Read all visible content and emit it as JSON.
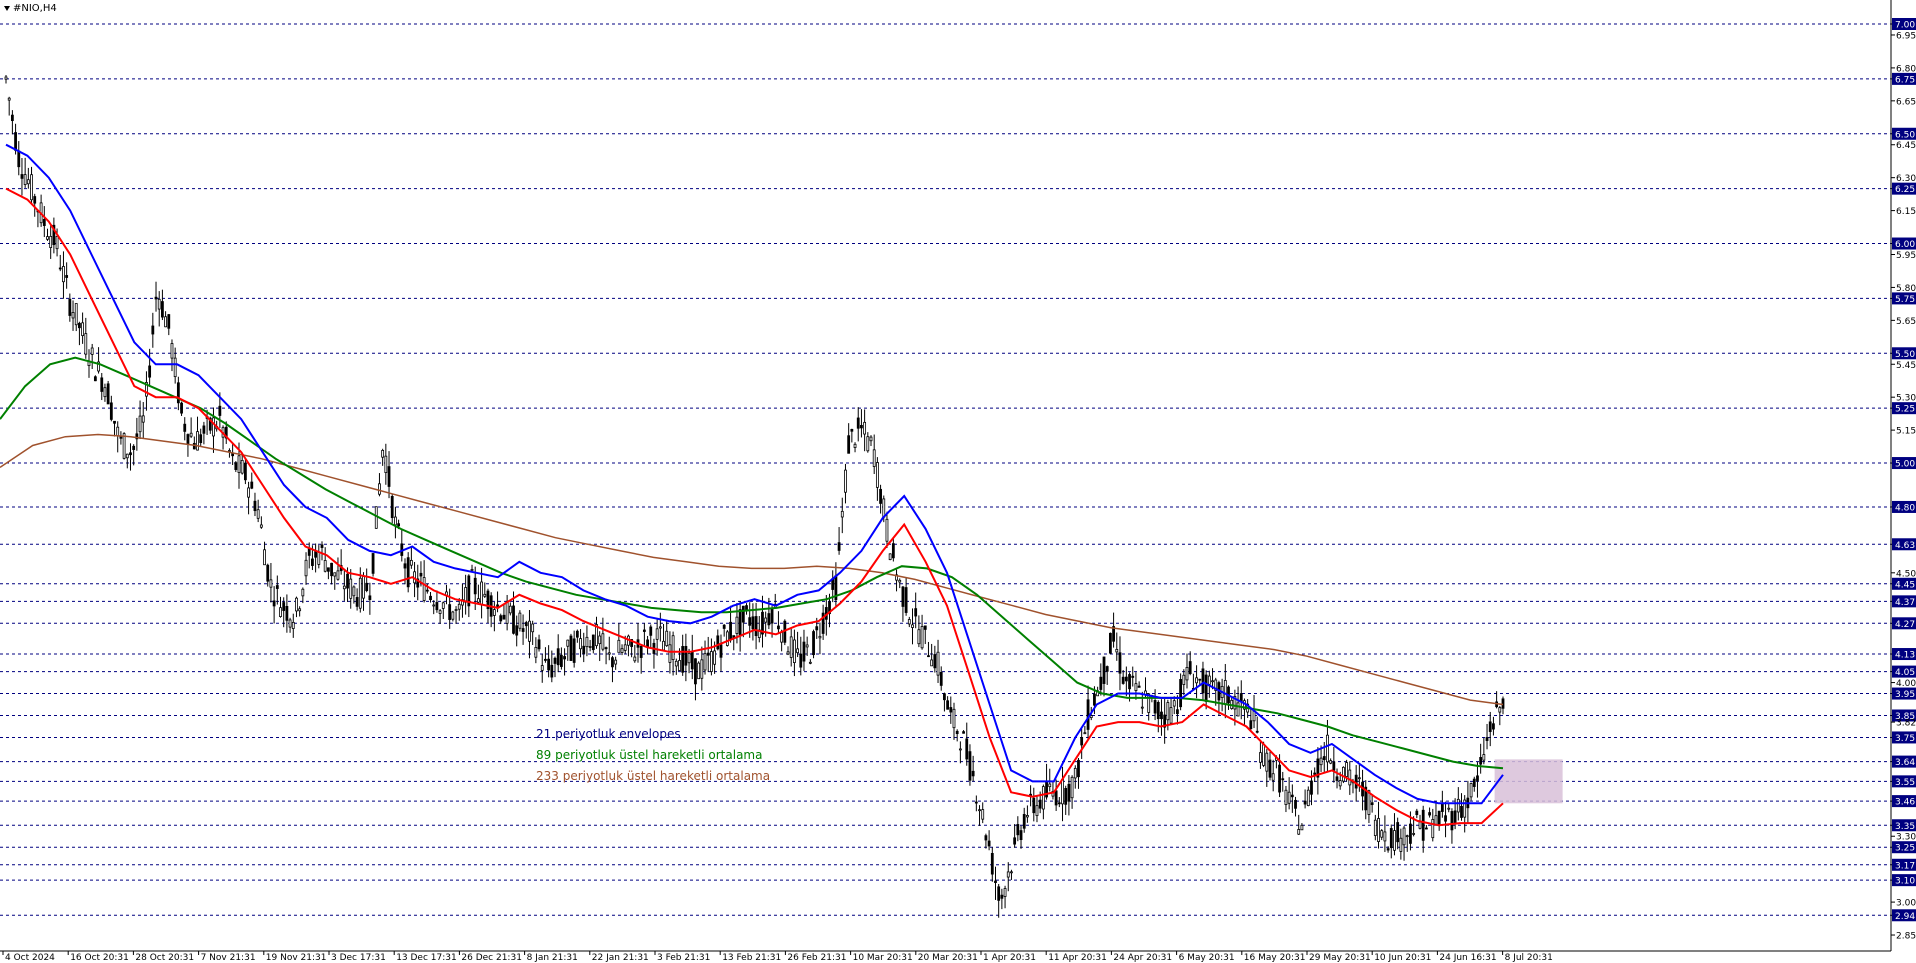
{
  "title": "#NIO,H4",
  "colors": {
    "envelope_upper": "#0000ff",
    "envelope_lower": "#ff0000",
    "ema89": "#008000",
    "ema233": "#a0522d",
    "highlight_zone": "#d8bfd8",
    "grid": "#000080",
    "candle": "#000000"
  },
  "legend": [
    {
      "label": "21 periyotluk envelopes",
      "color": "#000080"
    },
    {
      "label": "89 periyotluk üstel hareketli ortalama",
      "color": "#008000"
    },
    {
      "label": "233 periyotluk üstel hareketli ortalama",
      "color": "#a0522d"
    }
  ],
  "chart_data": {
    "type": "line",
    "price_range": [
      2.8,
      7.0
    ],
    "grid": "dashed horizontal at key levels",
    "y_ticks": [
      "7.00",
      "6.95",
      "6.80",
      "6.75",
      "6.65",
      "6.50",
      "6.45",
      "6.30",
      "6.25",
      "6.15",
      "6.00",
      "5.95",
      "5.80",
      "5.75",
      "5.65",
      "5.50",
      "5.45",
      "5.30",
      "5.25",
      "5.15",
      "5.00",
      "4.80",
      "4.63",
      "4.50",
      "4.45",
      "4.37",
      "4.27",
      "4.13",
      "4.05",
      "4.00",
      "3.95",
      "3.85",
      "3.82",
      "3.75",
      "3.64",
      "3.55",
      "3.46",
      "3.35",
      "3.30",
      "3.25",
      "3.17",
      "3.10",
      "3.00",
      "2.94",
      "2.85"
    ],
    "highlighted_levels": [
      "7.00",
      "6.75",
      "6.50",
      "6.25",
      "6.00",
      "5.75",
      "5.50",
      "5.25",
      "5.00",
      "4.80",
      "4.63",
      "4.45",
      "4.37",
      "4.27",
      "4.13",
      "4.05",
      "3.95",
      "3.85",
      "3.75",
      "3.64",
      "3.55",
      "3.46",
      "3.35",
      "3.25",
      "3.17",
      "3.10",
      "2.94"
    ],
    "x_ticks": [
      "4 Oct 2024",
      "16 Oct 20:31",
      "28 Oct 20:31",
      "7 Nov 21:31",
      "19 Nov 21:31",
      "3 Dec 17:31",
      "13 Dec 17:31",
      "26 Dec 21:31",
      "8 Jan 21:31",
      "22 Jan 21:31",
      "3 Feb 21:31",
      "13 Feb 21:31",
      "26 Feb 21:31",
      "10 Mar 20:31",
      "20 Mar 20:31",
      "1 Apr 20:31",
      "11 Apr 20:31",
      "24 Apr 20:31",
      "6 May 20:31",
      "16 May 20:31",
      "29 May 20:31",
      "10 Jun 20:31",
      "24 Jun 16:31",
      "8 Jul 20:31"
    ],
    "price_path": [
      6.75,
      6.4,
      6.25,
      6.1,
      6.0,
      5.75,
      5.6,
      5.45,
      5.35,
      5.1,
      5.05,
      5.2,
      5.8,
      5.6,
      5.2,
      5.1,
      5.15,
      5.2,
      5.0,
      4.95,
      4.8,
      4.45,
      4.35,
      4.3,
      4.55,
      4.6,
      4.5,
      4.45,
      4.4,
      4.45,
      5.1,
      4.7,
      4.5,
      4.45,
      4.4,
      4.35,
      4.3,
      4.45,
      4.4,
      4.35,
      4.3,
      4.25,
      4.2,
      4.05,
      4.1,
      4.15,
      4.2,
      4.2,
      4.1,
      4.15,
      4.15,
      4.2,
      4.2,
      4.15,
      4.1,
      4.05,
      4.1,
      4.2,
      4.25,
      4.3,
      4.25,
      4.35,
      4.2,
      4.1,
      4.15,
      4.3,
      4.45,
      5.1,
      5.15,
      5.05,
      4.7,
      4.45,
      4.3,
      4.2,
      4.1,
      3.85,
      3.75,
      3.55,
      3.3,
      3.0,
      3.2,
      3.4,
      3.45,
      3.5,
      3.5,
      3.55,
      3.85,
      4.0,
      4.2,
      4.0,
      3.95,
      3.9,
      3.85,
      3.9,
      4.05,
      4.0,
      3.95,
      3.95,
      3.9,
      3.85,
      3.65,
      3.6,
      3.45,
      3.35,
      3.6,
      3.7,
      3.6,
      3.55,
      3.5,
      3.35,
      3.3,
      3.3,
      3.35,
      3.35,
      3.38,
      3.4,
      3.45,
      3.55,
      3.8,
      3.9
    ],
    "series": [
      {
        "name": "21 periyotluk envelopes",
        "key": "env_upper",
        "values": [
          6.45,
          6.4,
          6.3,
          6.15,
          5.95,
          5.75,
          5.55,
          5.45,
          5.45,
          5.4,
          5.3,
          5.2,
          5.05,
          4.9,
          4.8,
          4.75,
          4.65,
          4.6,
          4.58,
          4.62,
          4.55,
          4.52,
          4.5,
          4.48,
          4.55,
          4.5,
          4.48,
          4.42,
          4.38,
          4.35,
          4.3,
          4.28,
          4.27,
          4.3,
          4.35,
          4.38,
          4.35,
          4.4,
          4.42,
          4.5,
          4.6,
          4.75,
          4.85,
          4.7,
          4.5,
          4.2,
          3.9,
          3.6,
          3.55,
          3.55,
          3.75,
          3.9,
          3.95,
          3.95,
          3.93,
          3.93,
          4.0,
          3.95,
          3.9,
          3.82,
          3.72,
          3.68,
          3.72,
          3.65,
          3.58,
          3.52,
          3.47,
          3.45,
          3.45,
          3.45,
          3.58
        ]
      },
      {
        "name": "21 periyotluk envelopes",
        "key": "env_lower",
        "values": [
          6.25,
          6.2,
          6.1,
          5.95,
          5.75,
          5.55,
          5.35,
          5.3,
          5.3,
          5.25,
          5.15,
          5.05,
          4.9,
          4.75,
          4.62,
          4.58,
          4.5,
          4.48,
          4.45,
          4.48,
          4.42,
          4.38,
          4.36,
          4.34,
          4.4,
          4.36,
          4.33,
          4.28,
          4.24,
          4.2,
          4.16,
          4.14,
          4.14,
          4.16,
          4.2,
          4.24,
          4.22,
          4.26,
          4.28,
          4.36,
          4.46,
          4.6,
          4.72,
          4.55,
          4.35,
          4.05,
          3.75,
          3.5,
          3.48,
          3.5,
          3.65,
          3.8,
          3.82,
          3.82,
          3.8,
          3.82,
          3.9,
          3.85,
          3.8,
          3.7,
          3.6,
          3.57,
          3.6,
          3.55,
          3.48,
          3.42,
          3.37,
          3.35,
          3.36,
          3.36,
          3.45
        ]
      },
      {
        "name": "89 periyotluk üstel hareketli ortalama",
        "key": "ema89",
        "values": [
          5.2,
          5.35,
          5.45,
          5.48,
          5.45,
          5.4,
          5.35,
          5.3,
          5.25,
          5.18,
          5.1,
          5.02,
          4.95,
          4.88,
          4.82,
          4.76,
          4.7,
          4.65,
          4.6,
          4.55,
          4.5,
          4.46,
          4.43,
          4.4,
          4.38,
          4.36,
          4.34,
          4.33,
          4.32,
          4.32,
          4.33,
          4.34,
          4.36,
          4.38,
          4.42,
          4.48,
          4.53,
          4.52,
          4.48,
          4.4,
          4.3,
          4.2,
          4.1,
          4.0,
          3.95,
          3.93,
          3.93,
          3.93,
          3.92,
          3.9,
          3.88,
          3.86,
          3.83,
          3.8,
          3.76,
          3.73,
          3.7,
          3.67,
          3.64,
          3.62,
          3.61
        ]
      },
      {
        "name": "233 periyotluk üstel hareketli ortalama",
        "key": "ema233",
        "values": [
          4.98,
          5.08,
          5.12,
          5.13,
          5.12,
          5.1,
          5.08,
          5.05,
          5.02,
          4.98,
          4.94,
          4.9,
          4.86,
          4.82,
          4.78,
          4.74,
          4.7,
          4.66,
          4.63,
          4.6,
          4.57,
          4.55,
          4.53,
          4.52,
          4.52,
          4.53,
          4.52,
          4.5,
          4.47,
          4.43,
          4.39,
          4.35,
          4.31,
          4.28,
          4.25,
          4.23,
          4.21,
          4.19,
          4.17,
          4.15,
          4.12,
          4.08,
          4.04,
          4.0,
          3.96,
          3.92,
          3.9
        ]
      }
    ],
    "highlight_zone": {
      "price_from": 3.45,
      "price_to": 3.65,
      "time_from": "8 Jul 20:31"
    }
  }
}
